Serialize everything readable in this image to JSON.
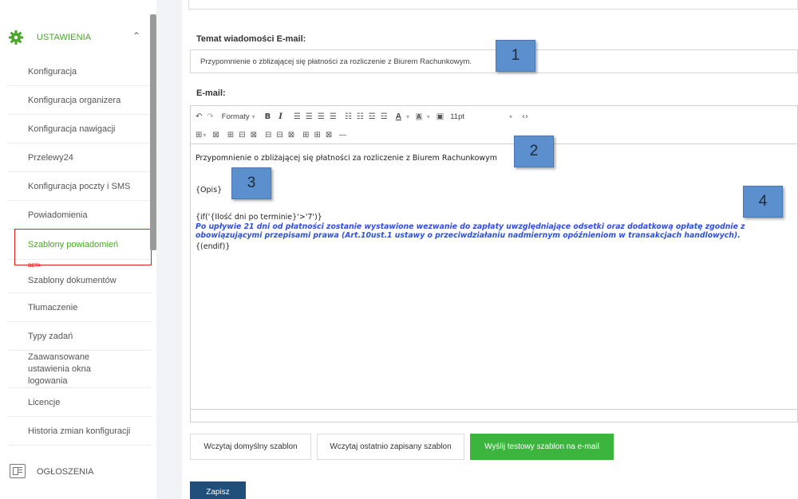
{
  "sidebar": {
    "section_label": "USTAWIENIA",
    "section_icon": "gear-icon",
    "accent_color": "#4aa72a",
    "items": [
      {
        "label": "Konfiguracja"
      },
      {
        "label": "Konfiguracja organizera"
      },
      {
        "label": "Konfiguracja nawigacji"
      },
      {
        "label": "Przelewy24"
      },
      {
        "label": "Konfiguracja poczty i SMS"
      },
      {
        "label": "Powiadomienia"
      },
      {
        "label": "Szablony powiadomień"
      },
      {
        "label": "Szablony dokumentów",
        "badge": "BETA"
      },
      {
        "label": "Tłumaczenie"
      },
      {
        "label": "Typy zadań"
      },
      {
        "label": "Zaawansowane ustawienia okna logowania"
      },
      {
        "label": "Licencje"
      },
      {
        "label": "Historia zmian konfiguracji"
      }
    ],
    "footer_label": "OGŁOSZENIA"
  },
  "form": {
    "subject_label": "Temat wiadomości E-mail:",
    "subject_value": "Przypomnienie o zbliżającej się płatności za rozliczenie z Biurem Rachunkowym.",
    "email_label": "E-mail:"
  },
  "toolbar": {
    "formats": "Formaty",
    "bold": "B",
    "italic": "I",
    "text_color": "A",
    "bg_color": "A",
    "font_size": "11pt"
  },
  "editor": {
    "line1": "Przypomnienie o zbliżającej się płatności za rozliczenie z Biurem Rachunkowym",
    "line2": "{Opis}",
    "line3": "{if('{Ilość dni po terminie}'>'7')}",
    "blue_text": "Po upływie 21 dni od płatności zostanie wystawione wezwanie do zapłaty  uwzględniające odsetki oraz dodatkową opłatę zgodnie z obowiązującymi przepisami prawa (Art.10ust.1 ustawy o przeciwdziałaniu nadmiernym opóźnieniom w transakcjach handlowych).",
    "line4": "{(endif)}"
  },
  "callouts": [
    "1",
    "2",
    "3",
    "4"
  ],
  "buttons": {
    "load_default": "Wczytaj domyślny szablon",
    "load_last": "Wczytaj ostatnio zapisany szablon",
    "send_test": "Wyślij testowy szablon na e-mail",
    "save": "Zapisz"
  }
}
